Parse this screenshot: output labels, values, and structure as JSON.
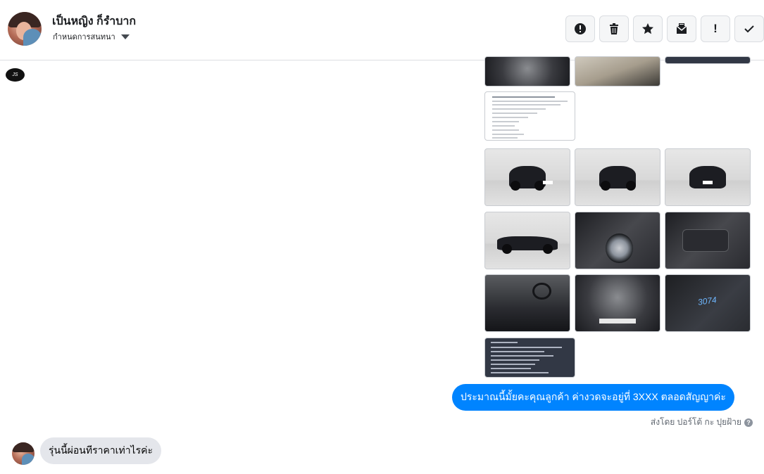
{
  "header": {
    "contact_name": "เป็นหญิง ก็รำบาก",
    "assign_label": "กำหนดการสนทนา"
  },
  "toolbar": {
    "buttons": [
      {
        "icon": "alert-circle-icon"
      },
      {
        "icon": "trash-icon"
      },
      {
        "icon": "star-icon"
      },
      {
        "icon": "mark-unread-icon"
      },
      {
        "icon": "exclamation-icon",
        "glyph": "!"
      },
      {
        "icon": "checkmark-icon"
      }
    ]
  },
  "thread": {
    "attachments_top": [
      "engine-photo",
      "seat-photo",
      "info-card-photo"
    ],
    "doc_attachment": "listing-document",
    "photo_grid": [
      "car-front-left",
      "car-rear-left",
      "car-rear",
      "car-side",
      "car-front-wheel",
      "car-door-panel",
      "car-interior-dashboard",
      "car-engine-bay",
      "car-battery",
      "car-info-card"
    ],
    "battery_scribble": "3074"
  },
  "messages": {
    "outgoing_text": "ประมาณนี้มั้ยคะคุณลูกค้า ค่างวดจะอยู่ที่ 3XXX ตลอดสัญญาค่ะ",
    "sent_by": "ส่งโดย ปอร์โต้ กะ ปุยฝ้าย",
    "incoming_text": "รุ่นนี้ผ่อนทีราคาเท่าไรค่ะ"
  },
  "colors": {
    "outgoing_bubble": "#0084ff",
    "incoming_bubble": "#e4e6eb",
    "info_card": "#323845"
  }
}
